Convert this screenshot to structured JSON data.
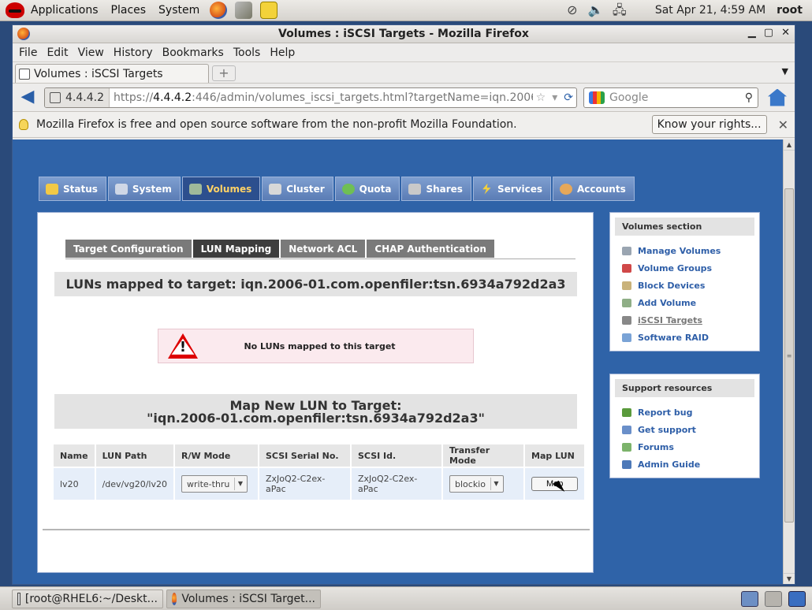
{
  "panel": {
    "menus": [
      "Applications",
      "Places",
      "System"
    ],
    "clock": "Sat Apr 21,  4:59 AM",
    "user": "root"
  },
  "window": {
    "title": "Volumes : iSCSI Targets - Mozilla Firefox",
    "menu": [
      "File",
      "Edit",
      "View",
      "History",
      "Bookmarks",
      "Tools",
      "Help"
    ],
    "tab_title": "Volumes : iSCSI Targets",
    "identity": "4.4.4.2",
    "url_prefix": "https://",
    "url_host": "4.4.4.2",
    "url_rest": ":446/admin/volumes_iscsi_targets.html?targetName=iqn.2006-01.cc",
    "search_placeholder": "Google"
  },
  "notice": {
    "text": "Mozilla Firefox is free and open source software from the non-profit Mozilla Foundation.",
    "button": "Know your rights..."
  },
  "main_tabs": [
    "Status",
    "System",
    "Volumes",
    "Cluster",
    "Quota",
    "Shares",
    "Services",
    "Accounts"
  ],
  "sub_tabs": [
    "Target Configuration",
    "LUN Mapping",
    "Network ACL",
    "CHAP Authentication"
  ],
  "luns_heading": "LUNs mapped to target: iqn.2006-01.com.openfiler:tsn.6934a792d2a3",
  "no_luns_message": "No LUNs mapped to this target",
  "map_heading_line1": "Map New LUN to Target:",
  "map_heading_line2": "\"iqn.2006-01.com.openfiler:tsn.6934a792d2a3\"",
  "lun_table": {
    "headers": [
      "Name",
      "LUN Path",
      "R/W Mode",
      "SCSI Serial No.",
      "SCSI Id.",
      "Transfer Mode",
      "Map LUN"
    ],
    "row": {
      "name": "lv20",
      "path": "/dev/vg20/lv20",
      "rw_mode": "write-thru",
      "serial": "ZxJoQ2-C2ex-aPac",
      "scsi_id": "ZxJoQ2-C2ex-aPac",
      "transfer_mode": "blockio",
      "map_button": "Map"
    }
  },
  "volumes_section": {
    "title": "Volumes section",
    "items": [
      "Manage Volumes",
      "Volume Groups",
      "Block Devices",
      "Add Volume",
      "iSCSI Targets",
      "Software RAID"
    ]
  },
  "support_section": {
    "title": "Support resources",
    "items": [
      "Report bug",
      "Get support",
      "Forums",
      "Admin Guide"
    ]
  },
  "taskbar": {
    "items": [
      "[root@RHEL6:~/Deskt...",
      "Volumes : iSCSI Target..."
    ]
  },
  "colors": {
    "page_bg": "#2f63a8",
    "active_tab_text": "#ffd266",
    "link": "#2f5fa8"
  }
}
